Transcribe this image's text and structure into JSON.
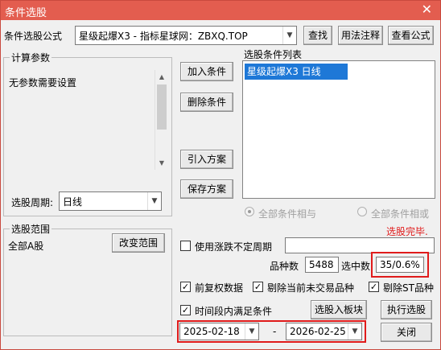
{
  "window": {
    "title": "条件选股",
    "close_glyph": "✕"
  },
  "formula": {
    "label": "条件选股公式",
    "selected": "星级起爆X3  -  指标星球网：ZBXQ.TOP",
    "find_button": "查找",
    "usage_button": "用法注释",
    "view_formula_button": "查看公式"
  },
  "params": {
    "group_label": "计算参数",
    "text": "无参数需要设置",
    "period_label": "选股周期:",
    "period_value": "日线"
  },
  "actions": {
    "add": "加入条件",
    "delete": "删除条件",
    "import": "引入方案",
    "save": "保存方案"
  },
  "conditions": {
    "group_label": "选股条件列表",
    "items": [
      {
        "text": "星级起爆X3  日线",
        "selected": true
      }
    ]
  },
  "logic": {
    "and_label": "全部条件相与",
    "or_label": "全部条件相或"
  },
  "status": {
    "text": "选股完毕.",
    "color": "#e01b1b"
  },
  "range": {
    "group_label": "选股范围",
    "text": "全部A股",
    "change_button": "改变范围"
  },
  "variable_period": {
    "label": "使用涨跌不定周期",
    "checked": false
  },
  "counts": {
    "total_label": "品种数",
    "total_value": "5488",
    "selected_label": "选中数",
    "selected_value": "35/0.6%"
  },
  "options": {
    "pre_adjust": {
      "label": "前复权数据",
      "checked": true
    },
    "exclude_untraded": {
      "label": "剔除当前未交易品种",
      "checked": true
    },
    "exclude_st": {
      "label": "剔除ST品种",
      "checked": true
    },
    "time_period": {
      "label": "时间段内满足条件",
      "checked": true
    }
  },
  "dates": {
    "start": "2025-02-18",
    "separator": "-",
    "end": "2026-02-25"
  },
  "buttons": {
    "to_block": "选股入板块",
    "execute": "执行选股",
    "close": "关闭"
  },
  "highlight_color": "#e01b1b"
}
